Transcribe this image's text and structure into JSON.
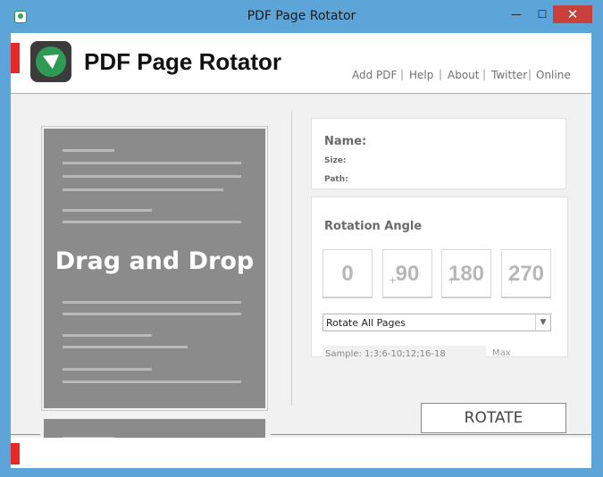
{
  "window": {
    "title": "PDF Page Rotator",
    "minimize_glyph": "—",
    "maximize_glyph": "☐",
    "close_glyph": "✕"
  },
  "header": {
    "app_title": "PDF Page Rotator",
    "nav": [
      "Add PDF",
      "Help",
      "About",
      "Twitter",
      "Online"
    ],
    "nav_separator": "|"
  },
  "dropzone": {
    "label": "Drag and Drop"
  },
  "file_info": {
    "name_label": "Name:",
    "size_label": "Size:",
    "path_label": "Path:"
  },
  "rotation": {
    "title": "Rotation Angle",
    "angles": [
      {
        "value": "0",
        "prefix": ""
      },
      {
        "value": "90",
        "prefix": "+"
      },
      {
        "value": "180",
        "prefix": "+"
      },
      {
        "value": "270",
        "prefix": "+"
      }
    ],
    "page_mode": "Rotate All Pages",
    "page_range_placeholder": "Sample: 1;3;6-10;12;16-18",
    "max_label": "Max"
  },
  "actions": {
    "rotate_label": "ROTATE"
  },
  "colors": {
    "titlebar": "#5da5d9",
    "accent_red": "#e8292b",
    "close_button": "#c7403a",
    "document_gray": "#8b8b8b"
  }
}
